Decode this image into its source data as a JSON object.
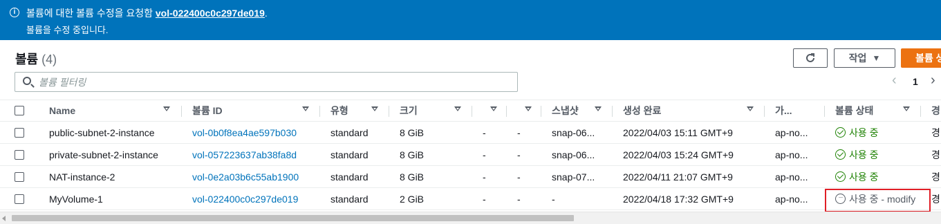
{
  "flash": {
    "message_prefix": "볼륨에 대한 볼륨 수정을 요청함 ",
    "volume_link": "vol-022400c0c297de019",
    "message_suffix": ".",
    "detail": "볼륨을 수정 중입니다.",
    "icon": "info-icon",
    "color": "#0073bb"
  },
  "panel": {
    "title": "볼륨",
    "count": "(4)"
  },
  "toolbar": {
    "refresh_icon": "refresh-icon",
    "actions_label": "작업",
    "create_label": "볼륨 생",
    "create_color": "#ec7211"
  },
  "search": {
    "placeholder": "볼륨 필터링",
    "value": ""
  },
  "pager": {
    "current_page": "1"
  },
  "columns": [
    "Name",
    "볼륨 ID",
    "유형",
    "크기",
    "",
    "",
    "스냅샷",
    "생성 완료",
    "가...",
    "볼륨 상태",
    "경"
  ],
  "rows": [
    {
      "name": "public-subnet-2-instance",
      "volume_id": "vol-0b0f8ea4ae597b030",
      "type": "standard",
      "size": "8 GiB",
      "c5": "-",
      "c6": "-",
      "snapshot": "snap-06...",
      "created": "2022/04/03 15:11 GMT+9",
      "az": "ap-no...",
      "status": "사용 중",
      "status_kind": "ok",
      "extra": "경"
    },
    {
      "name": "private-subnet-2-instance",
      "volume_id": "vol-057223637ab38fa8d",
      "type": "standard",
      "size": "8 GiB",
      "c5": "-",
      "c6": "-",
      "snapshot": "snap-06...",
      "created": "2022/04/03 15:24 GMT+9",
      "az": "ap-no...",
      "status": "사용 중",
      "status_kind": "ok",
      "extra": "경"
    },
    {
      "name": "NAT-instance-2",
      "volume_id": "vol-0e2a03b6c55ab1900",
      "type": "standard",
      "size": "8 GiB",
      "c5": "-",
      "c6": "-",
      "snapshot": "snap-07...",
      "created": "2022/04/11 21:07 GMT+9",
      "az": "ap-no...",
      "status": "사용 중",
      "status_kind": "ok",
      "extra": "경"
    },
    {
      "name": "MyVolume-1",
      "volume_id": "vol-022400c0c297de019",
      "type": "standard",
      "size": "2 GiB",
      "c5": "-",
      "c6": "-",
      "snapshot": "-",
      "created": "2022/04/18 17:32 GMT+9",
      "az": "ap-no...",
      "status": "사용 중 - modify",
      "status_kind": "pending",
      "extra": "경"
    }
  ]
}
